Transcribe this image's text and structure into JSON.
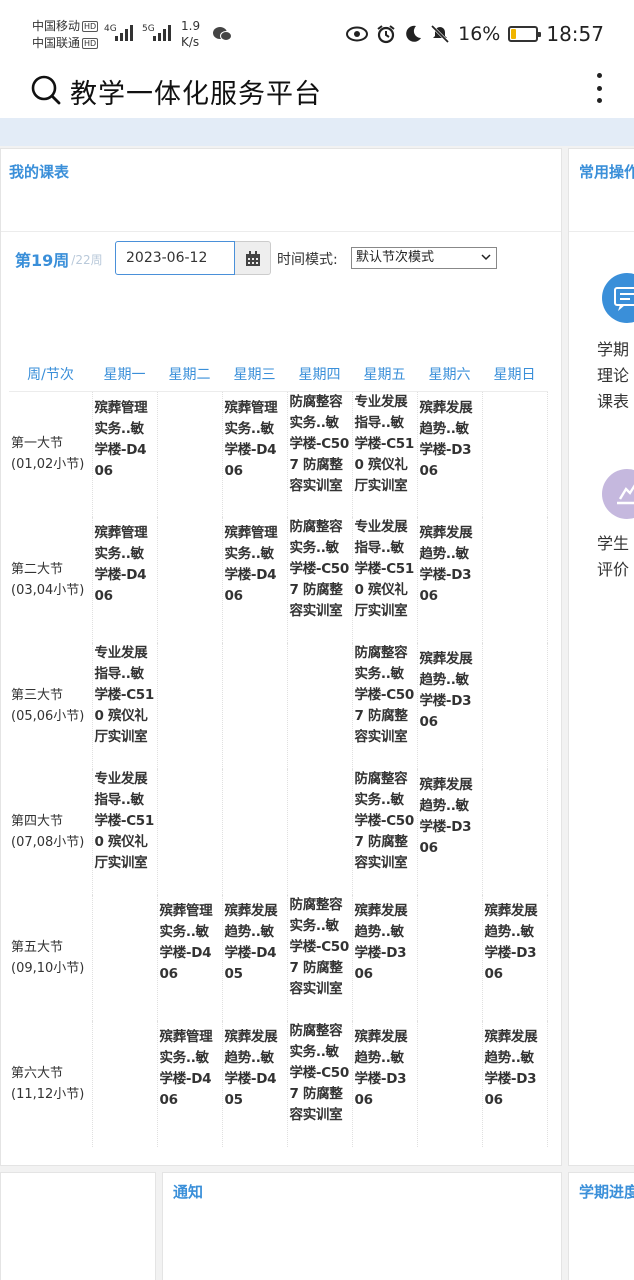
{
  "status_bar": {
    "carrier1": "中国移动",
    "carrier2": "中国联通",
    "hd": "HD",
    "signal1": "4G",
    "signal2": "5G",
    "speed_value": "1.9",
    "speed_unit": "K/s",
    "battery": "16%",
    "battery_level": 0.16,
    "time": "18:57"
  },
  "app_bar": {
    "title": "教学一体化服务平台"
  },
  "schedule": {
    "title": "我的课表",
    "week": "第19周",
    "week_total": "/22周",
    "date": "2023-06-12",
    "mode_label": "时间模式:",
    "mode_value": "默认节次模式",
    "headers": [
      "周/节次",
      "星期一",
      "星期二",
      "星期三",
      "星期四",
      "星期五",
      "星期六",
      "星期日"
    ],
    "rows": [
      {
        "period": "第一大节(01,02小节)",
        "cells": [
          "殡葬管理实务..敏学楼-D406",
          "",
          "殡葬管理实务..敏学楼-D406",
          "防腐整容实务..敏学楼-C507 防腐整容实训室",
          "专业发展指导..敏学楼-C510 殡仪礼厅实训室",
          "殡葬发展趋势..敏学楼-D306",
          ""
        ]
      },
      {
        "period": "第二大节(03,04小节)",
        "cells": [
          "殡葬管理实务..敏学楼-D406",
          "",
          "殡葬管理实务..敏学楼-D406",
          "防腐整容实务..敏学楼-C507 防腐整容实训室",
          "专业发展指导..敏学楼-C510 殡仪礼厅实训室",
          "殡葬发展趋势..敏学楼-D306",
          ""
        ]
      },
      {
        "period": "第三大节(05,06小节)",
        "cells": [
          "专业发展指导..敏学楼-C510 殡仪礼厅实训室",
          "",
          "",
          "",
          "防腐整容实务..敏学楼-C507 防腐整容实训室",
          "殡葬发展趋势..敏学楼-D306",
          ""
        ]
      },
      {
        "period": "第四大节(07,08小节)",
        "cells": [
          "专业发展指导..敏学楼-C510 殡仪礼厅实训室",
          "",
          "",
          "",
          "防腐整容实务..敏学楼-C507 防腐整容实训室",
          "殡葬发展趋势..敏学楼-D306",
          ""
        ]
      },
      {
        "period": "第五大节(09,10小节)",
        "cells": [
          "",
          "殡葬管理实务..敏学楼-D406",
          "殡葬发展趋势..敏学楼-D405",
          "防腐整容实务..敏学楼-C507 防腐整容实训室",
          "殡葬发展趋势..敏学楼-D306",
          "",
          "殡葬发展趋势..敏学楼-D306"
        ]
      },
      {
        "period": "第六大节(11,12小节)",
        "cells": [
          "",
          "殡葬管理实务..敏学楼-D406",
          "殡葬发展趋势..敏学楼-D405",
          "防腐整容实务..敏学楼-C507 防腐整容实训室",
          "殡葬发展趋势..敏学楼-D306",
          "",
          "殡葬发展趋势..敏学楼-D306"
        ]
      }
    ]
  },
  "quick_ops": {
    "title": "常用操作",
    "items": [
      {
        "label": "学期理论课表",
        "icon": "chat-icon",
        "color": "#3a8fd9"
      },
      {
        "label": "学生评价",
        "icon": "evaluate-icon",
        "color": "#b9a7d6"
      }
    ]
  },
  "notice": {
    "title": "通知"
  },
  "progress": {
    "title": "学期进度"
  }
}
